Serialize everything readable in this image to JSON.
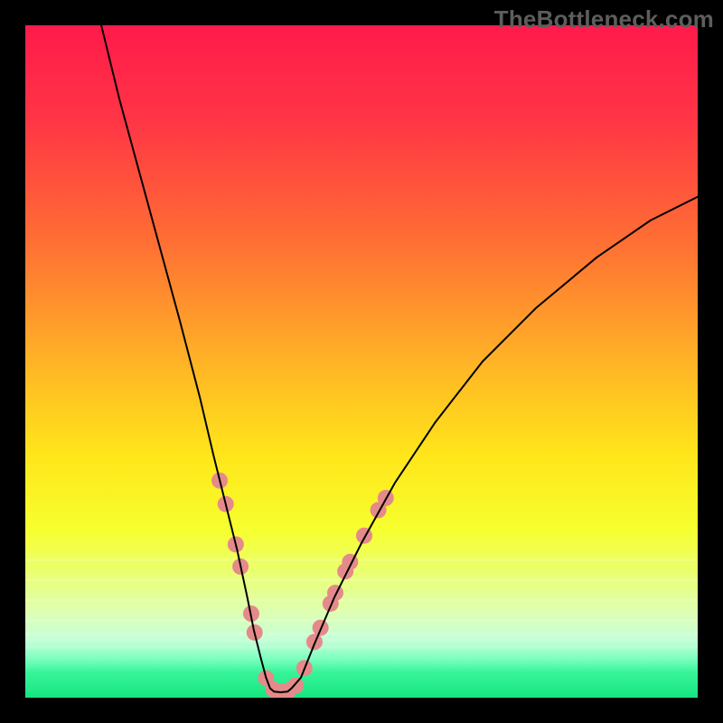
{
  "watermark": "TheBottleneck.com",
  "chart_data": {
    "type": "line",
    "title": "",
    "xlabel": "",
    "ylabel": "",
    "xlim": [
      0,
      100
    ],
    "ylim": [
      0,
      100
    ],
    "gradient_stops": [
      {
        "offset": 0,
        "color": "#ff1a4b"
      },
      {
        "offset": 0.14,
        "color": "#ff3545"
      },
      {
        "offset": 0.32,
        "color": "#ff6e34"
      },
      {
        "offset": 0.5,
        "color": "#ffb326"
      },
      {
        "offset": 0.64,
        "color": "#ffe61a"
      },
      {
        "offset": 0.75,
        "color": "#f6ff2e"
      },
      {
        "offset": 0.82,
        "color": "#e9ff77"
      },
      {
        "offset": 0.875,
        "color": "#ddffb5"
      },
      {
        "offset": 0.915,
        "color": "#c4ffd8"
      },
      {
        "offset": 0.942,
        "color": "#7dffbf"
      },
      {
        "offset": 0.962,
        "color": "#37f59a"
      },
      {
        "offset": 1.0,
        "color": "#17e57f"
      }
    ],
    "series": [
      {
        "name": "left-branch",
        "stroke": "#000000",
        "x": [
          11.3,
          14,
          17,
          20,
          23,
          26,
          28,
          30,
          31.5,
          33,
          34,
          35,
          35.8,
          36.4
        ],
        "y": [
          100,
          89,
          78,
          67,
          56,
          44.5,
          36,
          28,
          22,
          15,
          10,
          6,
          3,
          1.4
        ]
      },
      {
        "name": "right-branch",
        "stroke": "#000000",
        "x": [
          39.6,
          41,
          43,
          46,
          50,
          55,
          61,
          68,
          76,
          85,
          93,
          100
        ],
        "y": [
          1.4,
          3,
          8,
          15,
          23,
          32,
          41,
          50,
          58,
          65.5,
          71,
          74.5
        ]
      },
      {
        "name": "valley-floor",
        "stroke": "#000000",
        "x": [
          36.4,
          37,
          38,
          39,
          39.6
        ],
        "y": [
          1.4,
          0.9,
          0.8,
          0.9,
          1.4
        ]
      }
    ],
    "markers": {
      "color": "#e58a8a",
      "radius_px": 9,
      "points": [
        {
          "x": 28.9,
          "y": 32.3
        },
        {
          "x": 29.8,
          "y": 28.8
        },
        {
          "x": 31.3,
          "y": 22.8
        },
        {
          "x": 32.0,
          "y": 19.5
        },
        {
          "x": 33.6,
          "y": 12.5
        },
        {
          "x": 34.1,
          "y": 9.7
        },
        {
          "x": 35.8,
          "y": 2.9
        },
        {
          "x": 36.9,
          "y": 1.2
        },
        {
          "x": 38.0,
          "y": 0.9
        },
        {
          "x": 39.2,
          "y": 1.1
        },
        {
          "x": 40.2,
          "y": 1.8
        },
        {
          "x": 41.5,
          "y": 4.4
        },
        {
          "x": 43.0,
          "y": 8.3
        },
        {
          "x": 43.9,
          "y": 10.4
        },
        {
          "x": 45.4,
          "y": 14.0
        },
        {
          "x": 46.1,
          "y": 15.6
        },
        {
          "x": 47.6,
          "y": 18.8
        },
        {
          "x": 48.3,
          "y": 20.2
        },
        {
          "x": 50.4,
          "y": 24.1
        },
        {
          "x": 52.5,
          "y": 27.9
        },
        {
          "x": 53.6,
          "y": 29.7
        }
      ]
    }
  }
}
